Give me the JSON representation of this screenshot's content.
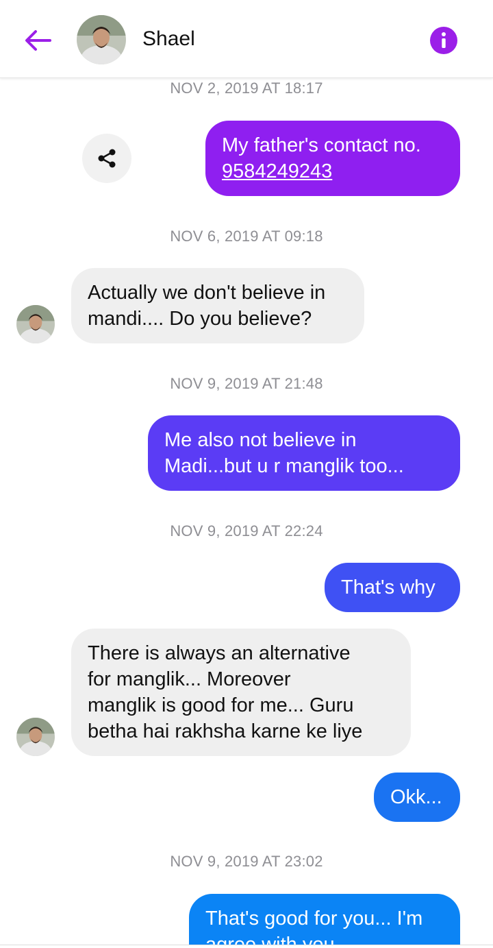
{
  "header": {
    "contact_name": "Shael",
    "back_icon": "arrow-left-icon",
    "info_icon": "info-icon",
    "accent": "#9b1fe8"
  },
  "messages": [
    {
      "type": "timestamp",
      "text": "NOV 2, 2019 AT 18:17"
    },
    {
      "type": "outgoing",
      "lines": [
        "My father's contact no."
      ],
      "link": "9584249243",
      "color": "#8f1ff0"
    },
    {
      "type": "timestamp",
      "text": "NOV 6, 2019 AT 09:18"
    },
    {
      "type": "incoming",
      "lines": [
        "Actually we don't believe in",
        "mandi.... Do you believe?"
      ]
    },
    {
      "type": "timestamp",
      "text": "NOV 9, 2019 AT 21:48"
    },
    {
      "type": "outgoing",
      "lines": [
        "Me also not believe in",
        "Madi...but u r manglik too..."
      ],
      "color": "#5b3cf5"
    },
    {
      "type": "timestamp",
      "text": "NOV 9, 2019 AT 22:24"
    },
    {
      "type": "outgoing",
      "lines": [
        "That's why"
      ],
      "color": "#3f51f4"
    },
    {
      "type": "incoming",
      "lines": [
        "There is always an alternative",
        "for manglik... Moreover",
        "manglik is good for me... Guru",
        "betha hai rakhsha karne ke liye"
      ]
    },
    {
      "type": "outgoing",
      "lines": [
        "Okk..."
      ],
      "color": "#1a73f2"
    },
    {
      "type": "timestamp",
      "text": "NOV 9, 2019 AT 23:02"
    },
    {
      "type": "outgoing",
      "lines": [
        "That's good for you... I'm",
        "agree with you"
      ],
      "color": "#0b84f5"
    }
  ],
  "share_icon": "share-icon"
}
